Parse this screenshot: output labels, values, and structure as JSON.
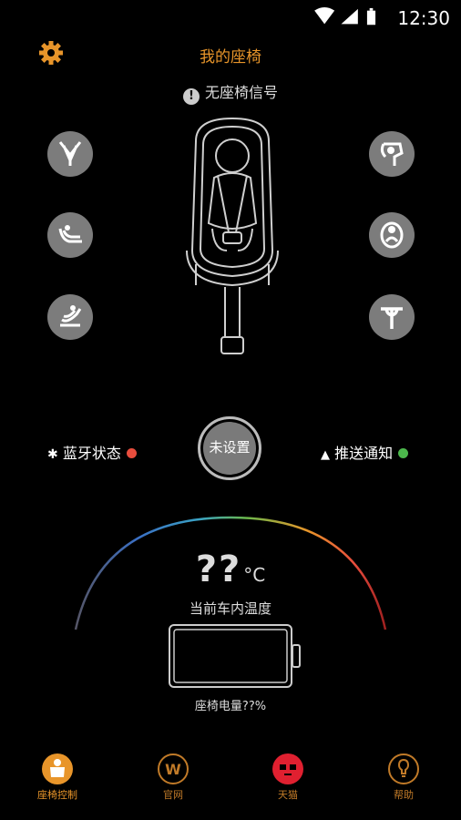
{
  "status_bar": {
    "time": "12:30"
  },
  "header": {
    "title": "我的座椅"
  },
  "signal": {
    "text": "无座椅信号",
    "icon": "warning-icon"
  },
  "features_left": [
    {
      "name": "harness-icon"
    },
    {
      "name": "recline-icon"
    },
    {
      "name": "rotate-seat-icon"
    }
  ],
  "features_right": [
    {
      "name": "headrest-icon"
    },
    {
      "name": "seat-front-icon"
    },
    {
      "name": "support-leg-icon"
    }
  ],
  "bluetooth": {
    "label": "蓝牙状态",
    "color": "#e84d3d"
  },
  "push": {
    "label": "推送通知",
    "color": "#4cb84c"
  },
  "center_button": {
    "label": "未设置"
  },
  "temperature": {
    "value": "??",
    "unit": "°C",
    "label": "当前车内温度"
  },
  "battery": {
    "label": "座椅电量??%"
  },
  "nav": [
    {
      "label": "座椅控制",
      "icon": "seat-control-icon",
      "active": true
    },
    {
      "label": "官网",
      "icon": "website-icon",
      "active": false
    },
    {
      "label": "天猫",
      "icon": "tmall-icon",
      "active": false
    },
    {
      "label": "帮助",
      "icon": "help-icon",
      "active": false
    }
  ],
  "colors": {
    "accent": "#e8952a",
    "background": "#000000",
    "button_gray": "#7c7c7c"
  }
}
